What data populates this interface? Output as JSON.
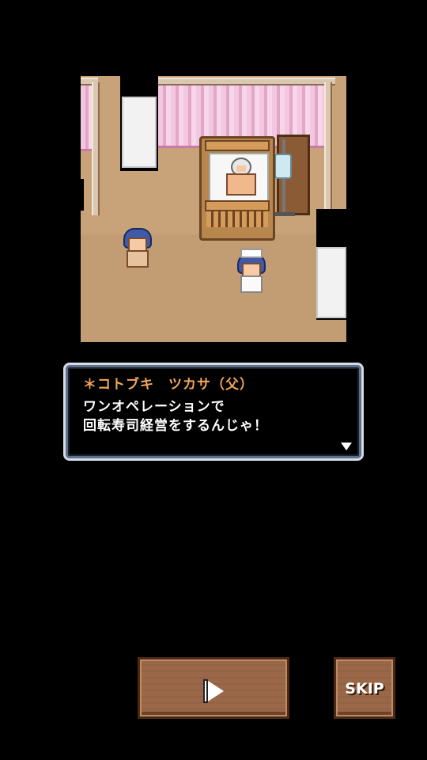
{
  "dialog": {
    "speaker": "＊コトブキ　ツカサ（父）",
    "line1": "ワンオペレーションで",
    "line2": "回転寿司経営をするんじゃ！"
  },
  "controls": {
    "advance_icon": "play-flag-icon",
    "skip_label": "SKIP"
  },
  "colors": {
    "speaker_name": "#f0a65a",
    "dialog_border": "#d6dbe6",
    "button_wood": "#9a6848"
  }
}
